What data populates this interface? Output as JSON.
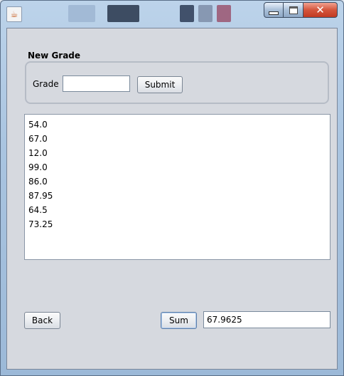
{
  "window": {
    "title": "",
    "close_glyph": "✕"
  },
  "form": {
    "group_title": "New Grade",
    "grade_label": "Grade",
    "grade_value": "",
    "submit_label": "Submit"
  },
  "grades": [
    "54.0",
    "67.0",
    "12.0",
    "99.0",
    "86.0",
    "87.95",
    "64.5",
    "73.25"
  ],
  "footer": {
    "back_label": "Back",
    "sum_label": "Sum",
    "sum_value": "67.9625"
  }
}
